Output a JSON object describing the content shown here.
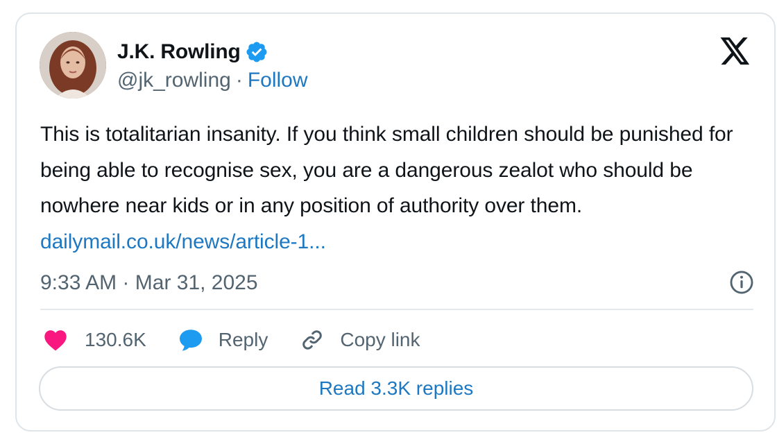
{
  "author": {
    "display_name": "J.K. Rowling",
    "handle": "@jk_rowling",
    "separator": "·",
    "follow_label": "Follow",
    "verified": true
  },
  "tweet": {
    "text": "This is totalitarian insanity. If you think small children should be punished for being able to recognise sex, you are a dangerous zealot who should be nowhere near kids or in any position of authority over them. ",
    "link_text": "dailymail.co.uk/news/article-1...",
    "time": "9:33 AM",
    "date_separator": "·",
    "date": "Mar 31, 2025"
  },
  "actions": {
    "like_count": "130.6K",
    "reply_label": "Reply",
    "copy_link_label": "Copy link"
  },
  "read_replies_label": "Read 3.3K replies",
  "icons": {
    "brand": "x-logo-icon",
    "verified": "verified-badge-icon",
    "info": "info-icon",
    "like": "heart-icon",
    "reply": "speech-bubble-icon",
    "copy": "link-icon"
  },
  "colors": {
    "link": "#1d78c1",
    "verified": "#1d9bf0",
    "like": "#f91880",
    "reply_icon": "#1d9bf0",
    "text": "#0f1419",
    "muted": "#536471"
  }
}
